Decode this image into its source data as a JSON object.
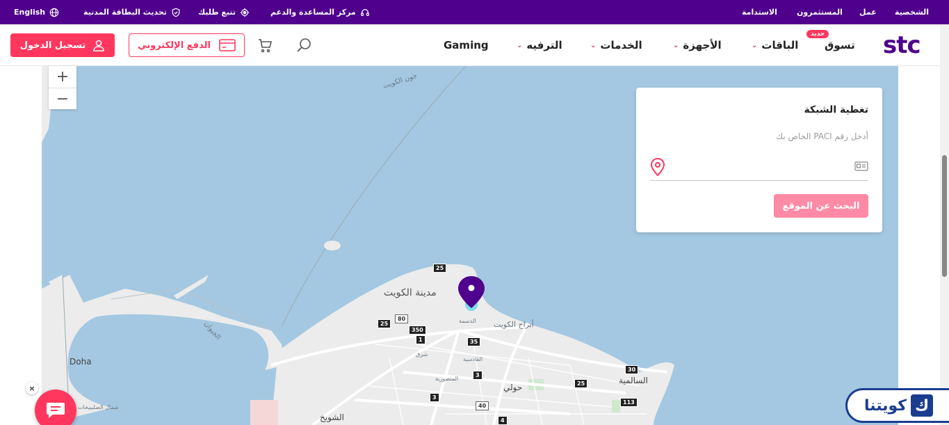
{
  "topbar": {
    "right_links": [
      "الشخصية",
      "عمل",
      "المستثمرون",
      "الاستدامة"
    ],
    "support": "مركز المساعدة والدعم",
    "track": "تتبع طلبك",
    "civil_id": "تحديث البطاقة المدنية",
    "language": "English"
  },
  "nav": {
    "logo": "stc",
    "shop": "تسوق",
    "new_badge": "جديد",
    "plans": "الباقات",
    "devices": "الأجهزة",
    "services": "الخدمات",
    "entertainment": "الترفيه",
    "gaming": "Gaming",
    "pay_label": "الدفع الإلكتروني",
    "login_label": "تسجيل الدخول"
  },
  "map": {
    "zoom_in": "+",
    "zoom_out": "−",
    "labels": {
      "bay": "جون الكويت",
      "city": "مدينة الكويت",
      "doha": "Doha",
      "shuwaikh": "الشويخ",
      "hawalli": "حولي",
      "salmiya": "السالمية",
      "jahra_road": "الجيوان",
      "dasma": "الدسمة",
      "qadsiya": "القادسية",
      "mansouriya": "المنصورية",
      "sharq": "شرق",
      "kuwait_towers": "أبراج الكويت",
      "north_sulaibikhat": "شمال الصليبيخات"
    },
    "highways": [
      "25",
      "80",
      "350",
      "1",
      "35",
      "3",
      "25",
      "113",
      "40",
      "3",
      "4",
      "25",
      "30"
    ]
  },
  "coverage": {
    "title": "تغطية الشبكة",
    "hint": "أدخل رقم PACI الخاص بك",
    "input_value": "",
    "button": "البحث عن الموقع"
  },
  "chat": {
    "close": "×"
  },
  "watermark": {
    "text": "كويتنا",
    "letter": "ك"
  },
  "colors": {
    "brand": "#4f008c",
    "accent": "#ff375e",
    "water": "#a4c8e1",
    "land": "#ececec"
  }
}
